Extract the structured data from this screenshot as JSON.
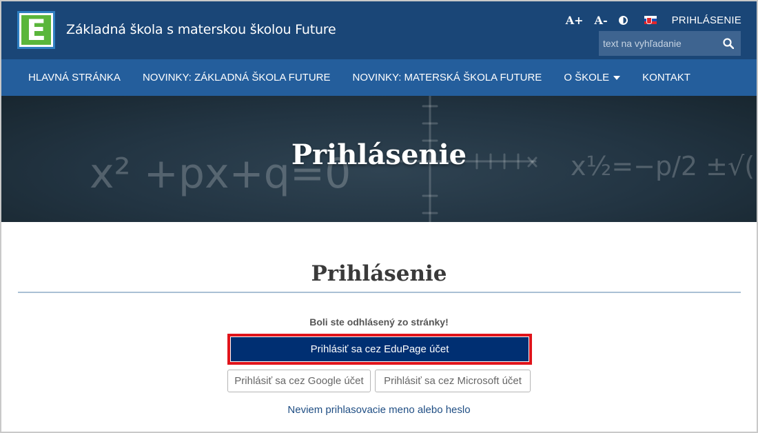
{
  "header": {
    "site_title": "Základná škola s materskou školou Future",
    "logo_letter": "E",
    "tools": {
      "font_increase": "A+",
      "font_decrease": "A-"
    },
    "login_label": "PRIHLÁSENIE",
    "search": {
      "placeholder": "text na vyhľadanie"
    }
  },
  "nav": {
    "items": [
      {
        "label": "HLAVNÁ STRÁNKA"
      },
      {
        "label": "NOVINKY: ZÁKLADNÁ ŠKOLA FUTURE"
      },
      {
        "label": "NOVINKY: MATERSKÁ ŠKOLA FUTURE"
      },
      {
        "label": "O ŠKOLE"
      },
      {
        "label": "KONTAKT"
      }
    ]
  },
  "hero": {
    "title": "Prihlásenie"
  },
  "main": {
    "heading": "Prihlásenie",
    "logout_message": "Boli ste odhlásený zo stránky!",
    "edupage_button": "Prihlásiť sa cez EduPage účet",
    "google_button": "Prihlásiť sa cez Google účet",
    "microsoft_button": "Prihlásiť sa cez Microsoft účet",
    "forgot_link": "Neviem prihlasovacie meno alebo heslo"
  },
  "colors": {
    "header_bg": "#1a4677",
    "nav_bg": "#245e9c",
    "primary_button": "#002f72",
    "highlight_border": "#e0141b",
    "logo_green": "#5ab63b"
  },
  "icons": {
    "search": "search-icon",
    "contrast": "contrast-icon",
    "flag": "slovak-flag-icon",
    "dropdown": "caret-down-icon"
  }
}
